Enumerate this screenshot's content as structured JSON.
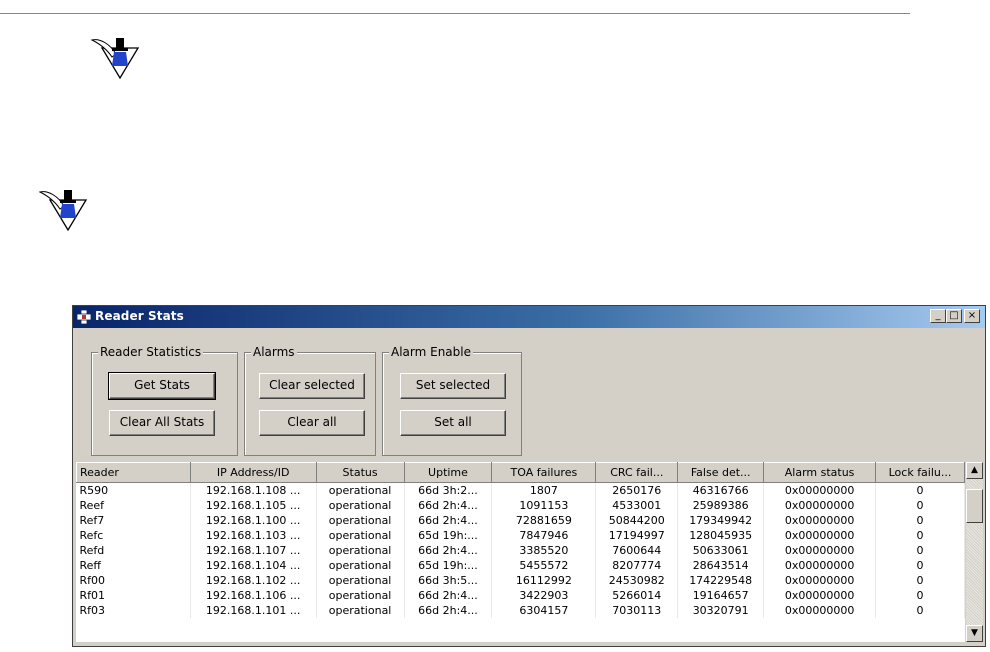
{
  "decor": {
    "note_icon_1": "note-pen-icon",
    "note_icon_2": "note-pen-icon",
    "rule_color": "#6aa532"
  },
  "window": {
    "title": "Reader Stats",
    "app_icon": "plus-cross-icon",
    "controls": {
      "minimize": "_",
      "maximize": "□",
      "close": "×"
    }
  },
  "groups": {
    "reader_statistics": {
      "label": "Reader Statistics",
      "buttons": [
        "Get Stats",
        "Clear All Stats"
      ]
    },
    "alarms": {
      "label": "Alarms",
      "buttons": [
        "Clear selected",
        "Clear all"
      ]
    },
    "alarm_enable": {
      "label": "Alarm Enable",
      "buttons": [
        "Set selected",
        "Set all"
      ]
    }
  },
  "table": {
    "columns": [
      "Reader",
      "IP Address/ID",
      "Status",
      "Uptime",
      "TOA failures",
      "CRC fail...",
      "False det...",
      "Alarm status",
      "Lock failu..."
    ],
    "rows": [
      [
        "R590",
        "192.168.1.108 ...",
        "operational",
        "66d 3h:2...",
        "1807",
        "2650176",
        "46316766",
        "0x00000000",
        "0"
      ],
      [
        "Reef",
        "192.168.1.105 ...",
        "operational",
        "66d 2h:4...",
        "1091153",
        "4533001",
        "25989386",
        "0x00000000",
        "0"
      ],
      [
        "Ref7",
        "192.168.1.100 ...",
        "operational",
        "66d 2h:4...",
        "72881659",
        "50844200",
        "179349942",
        "0x00000000",
        "0"
      ],
      [
        "Refc",
        "192.168.1.103 ...",
        "operational",
        "65d 19h:...",
        "7847946",
        "17194997",
        "128045935",
        "0x00000000",
        "0"
      ],
      [
        "Refd",
        "192.168.1.107 ...",
        "operational",
        "66d 2h:4...",
        "3385520",
        "7600644",
        "50633061",
        "0x00000000",
        "0"
      ],
      [
        "Reff",
        "192.168.1.104 ...",
        "operational",
        "65d 19h:...",
        "5455572",
        "8207774",
        "28643514",
        "0x00000000",
        "0"
      ],
      [
        "Rf00",
        "192.168.1.102 ...",
        "operational",
        "66d 3h:5...",
        "16112992",
        "24530982",
        "174229548",
        "0x00000000",
        "0"
      ],
      [
        "Rf01",
        "192.168.1.106 ...",
        "operational",
        "66d 2h:4...",
        "3422903",
        "5266014",
        "19164657",
        "0x00000000",
        "0"
      ],
      [
        "Rf03",
        "192.168.1.101 ...",
        "operational",
        "66d 2h:4...",
        "6304157",
        "7030113",
        "30320791",
        "0x00000000",
        "0"
      ]
    ]
  },
  "scrollbar": {
    "up": "▲",
    "down": "▼"
  }
}
